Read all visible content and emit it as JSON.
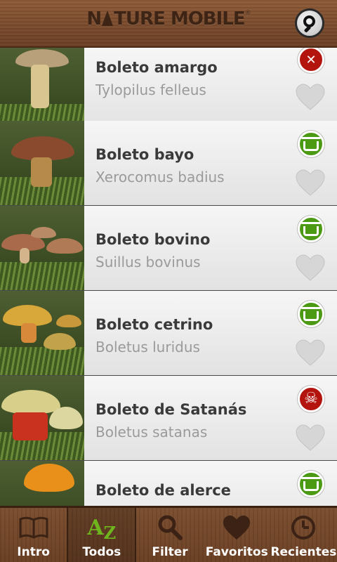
{
  "header": {
    "logo_part1": "N",
    "logo_part2": "TURE MOBILE",
    "logo_reg": "®"
  },
  "list": [
    {
      "name": "Boleto amargo",
      "latin": "Tylopilus felleus",
      "status": "bad",
      "status_icon": "crossed-utensils-icon"
    },
    {
      "name": "Boleto bayo",
      "latin": "Xerocomus badius",
      "status": "edible",
      "status_icon": "basket-icon"
    },
    {
      "name": "Boleto bovino",
      "latin": "Suillus bovinus",
      "status": "edible",
      "status_icon": "basket-icon"
    },
    {
      "name": "Boleto cetrino",
      "latin": "Boletus luridus",
      "status": "edible",
      "status_icon": "basket-icon"
    },
    {
      "name": "Boleto de Satanás",
      "latin": "Boletus satanas",
      "status": "deadly",
      "status_icon": "skull-icon"
    },
    {
      "name": "Boleto de alerce",
      "latin": "",
      "status": "edible",
      "status_icon": "basket-icon"
    }
  ],
  "tabs": [
    {
      "label": "Intro",
      "icon": "book-icon",
      "active": false
    },
    {
      "label": "Todos",
      "icon": "az-icon",
      "active": true,
      "icon_text": "AZ"
    },
    {
      "label": "Filter",
      "icon": "search-icon",
      "active": false
    },
    {
      "label": "Favoritos",
      "icon": "heart-icon",
      "active": false
    },
    {
      "label": "Recientes",
      "icon": "clock-icon",
      "active": false
    }
  ],
  "colors": {
    "edible": "#4c9a14",
    "poison": "#b3140e",
    "wood": "#7a4a2c",
    "active_tab_icon": "#6fb51e"
  }
}
